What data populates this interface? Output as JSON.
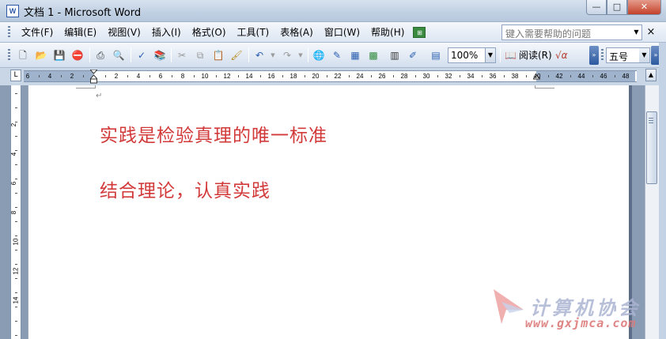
{
  "window": {
    "title": "文档 1 - Microsoft Word",
    "icon_label": "W",
    "min_glyph": "—",
    "max_glyph": "□",
    "close_glyph": "✕"
  },
  "menu": {
    "items": [
      "文件(F)",
      "编辑(E)",
      "视图(V)",
      "插入(I)",
      "格式(O)",
      "工具(T)",
      "表格(A)",
      "窗口(W)",
      "帮助(H)"
    ],
    "help_placeholder": "键入需要帮助的问题",
    "doc_close_glyph": "×",
    "dropdown_glyph": "▼"
  },
  "toolbar": {
    "zoom_value": "100%",
    "read_label": "阅读(R)",
    "formula_label": "√α",
    "font_size_value": "五号",
    "overflow_glyph": "»",
    "icons": [
      "new-doc-icon",
      "open-folder-icon",
      "save-icon",
      "permission-icon",
      "print-icon",
      "print-preview-icon",
      "spelling-icon",
      "research-icon",
      "cut-icon",
      "copy-icon",
      "paste-icon",
      "format-painter-icon",
      "undo-icon",
      "redo-icon",
      "hyperlink-icon",
      "tables-borders-icon",
      "insert-table-icon",
      "insert-excel-icon",
      "columns-icon",
      "drawing-icon",
      "document-map-icon"
    ]
  },
  "ruler": {
    "h_labels": [
      "6",
      "4",
      "2",
      "2",
      "4",
      "6",
      "8",
      "10",
      "12",
      "14",
      "16",
      "18",
      "20",
      "22",
      "24",
      "26",
      "28",
      "30",
      "32",
      "34",
      "36",
      "38",
      "40",
      "42",
      "44",
      "46",
      "48"
    ],
    "v_labels": [
      "2",
      "4",
      "6",
      "8",
      "10",
      "12",
      "14"
    ],
    "corner_glyph": "L"
  },
  "document": {
    "lines": [
      "实践是检验真理的唯一标准",
      "结合理论，认真实践"
    ],
    "paragraph_mark": "↵"
  },
  "watermark": {
    "title": "计算机协会",
    "url": "www.gxjmca.com"
  },
  "colors": {
    "text_red": "#d23a3a",
    "chrome_blue": "#c9d6e6"
  }
}
